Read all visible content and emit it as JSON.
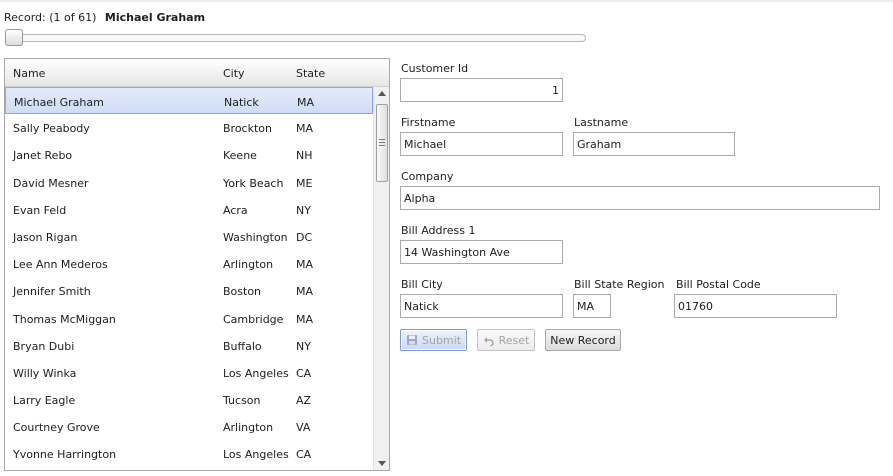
{
  "record": {
    "label": "Record:",
    "position": "(1 of 61)",
    "current_name": "Michael Graham",
    "slider_value": 1,
    "slider_min": 1,
    "slider_max": 61
  },
  "grid": {
    "columns": [
      "Name",
      "City",
      "State"
    ],
    "rows": [
      {
        "name": "Michael Graham",
        "city": "Natick",
        "state": "MA",
        "selected": true
      },
      {
        "name": "Sally Peabody",
        "city": "Brockton",
        "state": "MA"
      },
      {
        "name": "Janet Rebo",
        "city": "Keene",
        "state": "NH"
      },
      {
        "name": "David Mesner",
        "city": "York Beach",
        "state": "ME"
      },
      {
        "name": "Evan Feld",
        "city": "Acra",
        "state": "NY"
      },
      {
        "name": "Jason Rigan",
        "city": "Washington",
        "state": "DC"
      },
      {
        "name": "Lee Ann Mederos",
        "city": "Arlington",
        "state": "MA"
      },
      {
        "name": "Jennifer Smith",
        "city": "Boston",
        "state": "MA"
      },
      {
        "name": "Thomas McMiggan",
        "city": "Cambridge",
        "state": "MA"
      },
      {
        "name": "Bryan Dubi",
        "city": "Buffalo",
        "state": "NY"
      },
      {
        "name": "Willy Winka",
        "city": "Los Angeles",
        "state": "CA"
      },
      {
        "name": "Larry Eagle",
        "city": "Tucson",
        "state": "AZ"
      },
      {
        "name": "Courtney Grove",
        "city": "Arlington",
        "state": "VA"
      },
      {
        "name": "Yvonne Harrington",
        "city": "Los Angeles",
        "state": "CA"
      }
    ]
  },
  "form": {
    "customer_id": {
      "label": "Customer Id",
      "value": "1"
    },
    "firstname": {
      "label": "Firstname",
      "value": "Michael"
    },
    "lastname": {
      "label": "Lastname",
      "value": "Graham"
    },
    "company": {
      "label": "Company",
      "value": "Alpha"
    },
    "bill_address_1": {
      "label": "Bill Address 1",
      "value": "14 Washington Ave"
    },
    "bill_city": {
      "label": "Bill City",
      "value": "Natick"
    },
    "bill_state_region": {
      "label": "Bill State Region",
      "value": "MA"
    },
    "bill_postal_code": {
      "label": "Bill Postal Code",
      "value": "01760"
    }
  },
  "buttons": {
    "submit": "Submit",
    "reset": "Reset",
    "new_record": "New Record"
  },
  "icons": {
    "submit": "save-disk-icon",
    "reset": "undo-arrow-icon"
  },
  "colors": {
    "selection": "#cfdcf7",
    "selection_border": "#8aa8e8",
    "disabled_text": "#a3a3a3"
  }
}
